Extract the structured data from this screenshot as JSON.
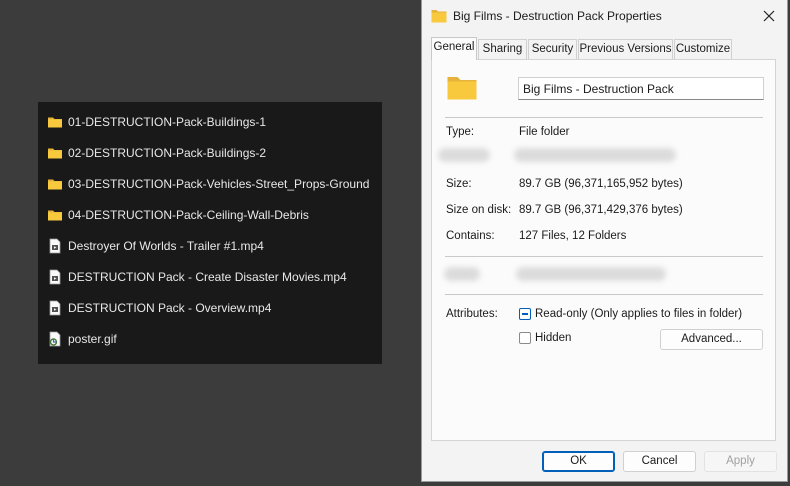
{
  "file_list": {
    "items": [
      {
        "name": "01-DESTRUCTION-Pack-Buildings-1",
        "type": "folder"
      },
      {
        "name": "02-DESTRUCTION-Pack-Buildings-2",
        "type": "folder"
      },
      {
        "name": "03-DESTRUCTION-Pack-Vehicles-Street_Props-Ground",
        "type": "folder"
      },
      {
        "name": "04-DESTRUCTION-Pack-Ceiling-Wall-Debris",
        "type": "folder"
      },
      {
        "name": "Destroyer Of Worlds - Trailer #1.mp4",
        "type": "video-file"
      },
      {
        "name": "DESTRUCTION Pack - Create Disaster Movies.mp4",
        "type": "video-file"
      },
      {
        "name": "DESTRUCTION Pack - Overview.mp4",
        "type": "video-file"
      },
      {
        "name": "poster.gif",
        "type": "image-file"
      }
    ]
  },
  "dialog": {
    "title": "Big Films - Destruction Pack Properties",
    "close_icon": "close-icon",
    "tabs": [
      "General",
      "Sharing",
      "Security",
      "Previous Versions",
      "Customize"
    ],
    "active_tab": "General",
    "name_value": "Big Films - Destruction Pack",
    "type_label": "Type:",
    "type_value": "File folder",
    "size_label": "Size:",
    "size_value": "89.7 GB (96,371,165,952 bytes)",
    "size_on_disk_label": "Size on disk:",
    "size_on_disk_value": "89.7 GB (96,371,429,376 bytes)",
    "contains_label": "Contains:",
    "contains_value": "127 Files, 12 Folders",
    "attributes_label": "Attributes:",
    "readonly_label": "Read-only (Only applies to files in folder)",
    "hidden_label": "Hidden",
    "advanced_button": "Advanced...",
    "ok_button": "OK",
    "cancel_button": "Cancel",
    "apply_button": "Apply"
  },
  "colors": {
    "folder_yellow": "#f8c93c",
    "accent_blue": "#005fb8",
    "dark_panel": "#191919",
    "desktop_bg": "#3c3c3c"
  }
}
